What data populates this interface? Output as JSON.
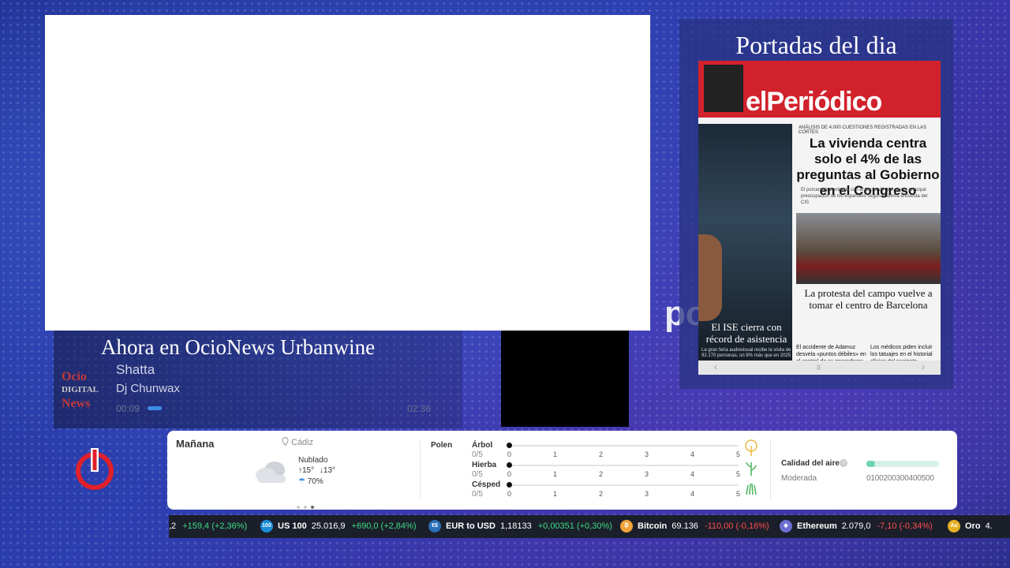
{
  "now_playing": {
    "title": "Ahora en OcioNews Urbanwine",
    "song": "Shatta",
    "artist": "Dj Chunwax",
    "elapsed": "00:09",
    "duration": "02:36",
    "progress_fraction": 0.06,
    "logo_line1": "Ocio",
    "logo_line2": "DIGITAL",
    "logo_line3": "News"
  },
  "portadas": {
    "title": "Portadas del dia",
    "paper": {
      "masthead": "elPeriódico",
      "kicker": "ANÁLISIS DE 4.000 CUESTIONES REGISTRADAS EN LAS CORTES",
      "headline": "La vivienda centra solo el 4% de las preguntas al Gobierno en el Congreso",
      "lead": "El porcentaje contrasta con el hecho de que sea la principal preocupación de los españoles según la última encuesta del CIS",
      "second_headline": "La protesta del campo vuelve a tomar el centro de Barcelona",
      "left_headline": "El ISE cierra con récord de asistencia",
      "left_sub": "La gran feria audiovisual recibe la visita de 92.170 personas, un 8% más que en 2025",
      "brief1": "El accidente de Adamuz desvela «puntos débiles» en el control de su operadores",
      "brief2": "Los médicos piden incluir los tatuajes en el historial clínico del paciente",
      "nav_prev": "‹",
      "nav_pause": "II",
      "nav_next": "›"
    }
  },
  "brand_fragment": "po",
  "weather": {
    "day": "Mañana",
    "location": "Cádiz",
    "condition": "Nublado",
    "high": "15°",
    "low": "13°",
    "rain": "70%",
    "pollen_label": "Polen",
    "pollen": [
      {
        "name": "Árbol",
        "value": "0/5",
        "level": 0
      },
      {
        "name": "Hierba",
        "value": "0/5",
        "level": 0
      },
      {
        "name": "Césped",
        "value": "0/5",
        "level": 0
      }
    ],
    "scale": [
      "0",
      "1",
      "2",
      "3",
      "4",
      "5"
    ],
    "air_label": "Calidad del aire",
    "air_level": "Moderada",
    "air_fraction": 0.12,
    "air_scale": "0100200300400500"
  },
  "ticker": [
    {
      "name": "",
      "value": ",2",
      "change": "+159,4 (+2,36%)",
      "dir": "up",
      "icon": "",
      "color": "#1b1f2a"
    },
    {
      "name": "US 100",
      "value": "25.016,9",
      "change": "+690,0 (+2,84%)",
      "dir": "up",
      "icon": "100",
      "color": "#1a8cd8"
    },
    {
      "name": "EUR to USD",
      "value": "1,18133",
      "change": "+0,00351 (+0,30%)",
      "dir": "up",
      "icon": "€$",
      "color": "#2a6fb8"
    },
    {
      "name": "Bitcoin",
      "value": "69.136",
      "change": "-110,00 (-0,16%)",
      "dir": "down",
      "icon": "₿",
      "color": "#f2a33a"
    },
    {
      "name": "Ethereum",
      "value": "2.079,0",
      "change": "-7,10 (-0,34%)",
      "dir": "down",
      "icon": "◆",
      "color": "#6b6fd1"
    },
    {
      "name": "Oro",
      "value": "4.",
      "change": "",
      "dir": "up",
      "icon": "Au",
      "color": "#e6b022"
    }
  ]
}
